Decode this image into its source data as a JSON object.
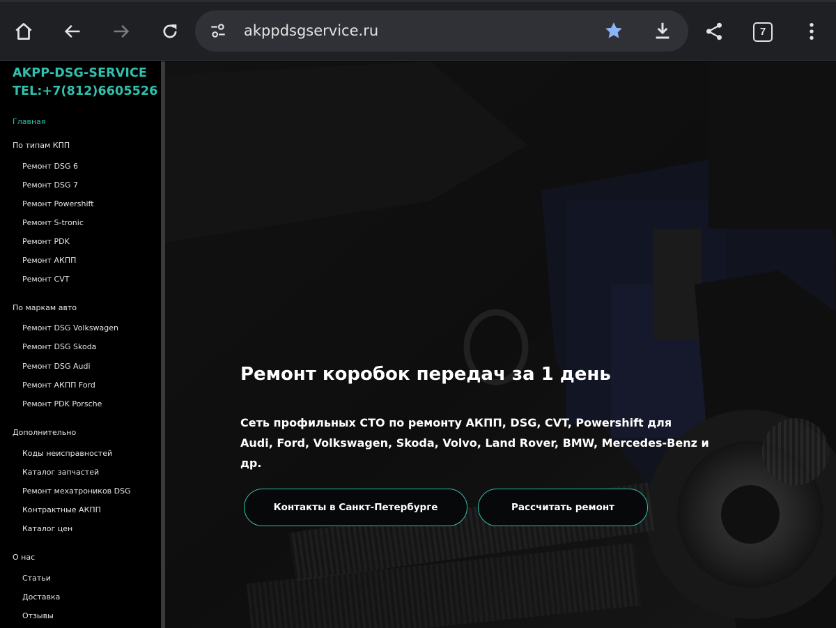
{
  "browser": {
    "url": "akppdsgservice.ru",
    "tab_count": "7"
  },
  "sidebar": {
    "brand_line1": "AKPP-DSG-SERVICE",
    "brand_line2": "TEL:+7(812)6605526",
    "active_item": "Главная",
    "sections": [
      {
        "title": "По типам КПП",
        "items": [
          "Ремонт DSG 6",
          "Ремонт DSG 7",
          "Ремонт Powershift",
          "Ремонт S-tronic",
          "Ремонт PDK",
          "Ремонт АКПП",
          "Ремонт CVT"
        ]
      },
      {
        "title": "По маркам авто",
        "items": [
          "Ремонт DSG Volkswagen",
          "Ремонт DSG Skoda",
          "Ремонт DSG Audi",
          "Ремонт АКПП Ford",
          "Ремонт PDK Porsche"
        ]
      },
      {
        "title": "Дополнительно",
        "items": [
          "Коды неисправностей",
          "Каталог запчастей",
          "Ремонт мехатроников DSG",
          "Контрактные АКПП",
          "Каталог цен"
        ]
      },
      {
        "title": "О нас",
        "items": [
          "Статьи",
          "Доставка",
          "Отзывы"
        ]
      }
    ]
  },
  "hero": {
    "title": "Ремонт коробок передач за 1 день",
    "description_line1": "Сеть профильных СТО по ремонту АКПП, DSG, CVT, Powershift для",
    "description_line2": "Audi, Ford, Volkswagen, Skoda, Volvo, Land Rover, BMW, Mercedes-Benz и др.",
    "button_contacts": "Контакты в Санкт-Петербурге",
    "button_calculate": "Рассчитать ремонт"
  },
  "colors": {
    "accent": "#2fc1ad",
    "toolbar_bg": "#1f2023",
    "omnibox_bg": "#303136",
    "star": "#8ab4f8"
  },
  "icons": [
    "home-icon",
    "back-arrow-icon",
    "forward-arrow-icon",
    "reload-icon",
    "site-settings-icon",
    "bookmark-star-icon",
    "download-icon",
    "share-icon",
    "tab-switcher-icon",
    "more-menu-icon"
  ]
}
